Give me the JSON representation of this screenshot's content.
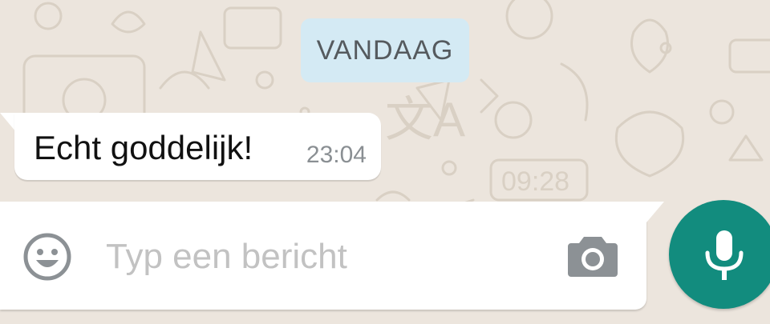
{
  "chat": {
    "date_separator": "VANDAAG",
    "messages": [
      {
        "text": "Echt goddelijk!",
        "time": "23:04",
        "direction": "incoming"
      }
    ]
  },
  "composer": {
    "placeholder": "Typ een bericht",
    "value": "",
    "emoji_icon": "smiley-icon",
    "camera_icon": "camera-icon",
    "mic_icon": "microphone-icon"
  },
  "colors": {
    "chat_background": "#ece5dd",
    "date_chip": "#d4eaf4",
    "bubble": "#ffffff",
    "mic_button": "#128c7e"
  }
}
